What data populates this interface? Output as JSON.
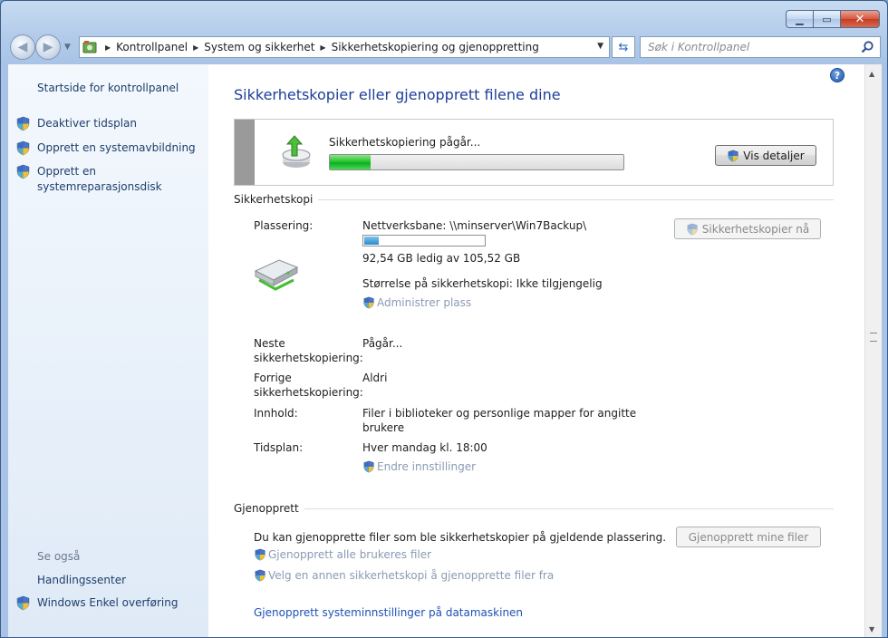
{
  "window": {
    "minimize_label": "▁",
    "maximize_label": "▭",
    "close_label": "✕"
  },
  "navbar": {
    "breadcrumbs": [
      "Kontrollpanel",
      "System og sikkerhet",
      "Sikkerhetskopiering og gjenoppretting"
    ],
    "search_placeholder": "Søk i Kontrollpanel"
  },
  "sidebar": {
    "home_label": "Startside for kontrollpanel",
    "items": [
      {
        "label": "Deaktiver tidsplan"
      },
      {
        "label": "Opprett en systemavbildning"
      },
      {
        "label": "Opprett en"
      },
      {
        "label": "systemreparasjonsdisk"
      }
    ],
    "see_also": "Se også",
    "see_also_items": [
      {
        "label": "Handlingssenter"
      },
      {
        "label": "Windows Enkel overføring"
      }
    ]
  },
  "main": {
    "title": "Sikkerhetskopier eller gjenopprett filene dine",
    "progress": {
      "label": "Sikkerhetskopiering pågår...",
      "fraction": 0.14,
      "details_button": "Vis detaljer"
    },
    "backup": {
      "section": "Sikkerhetskopi",
      "backup_now_button": "Sikkerhetskopier nå",
      "location_label": "Plassering:",
      "location_value": "Nettverksbane: \\\\minserver\\Win7Backup\\",
      "capacity_fraction": 0.12,
      "free_space": "92,54 GB ledig av 105,52 GB",
      "size": "Størrelse på sikkerhetskopi: Ikke tilgjengelig",
      "manage_space": "Administrer plass",
      "next_label_1": "Neste",
      "next_label_2": "sikkerhetskopiering:",
      "next_value": "Pågår...",
      "prev_label_1": "Forrige",
      "prev_label_2": "sikkerhetskopiering:",
      "prev_value": "Aldri",
      "content_label": "Innhold:",
      "content_value_1": "Filer i biblioteker og personlige mapper for angitte",
      "content_value_2": "brukere",
      "schedule_label": "Tidsplan:",
      "schedule_value": "Hver mandag kl. 18:00",
      "change_settings": "Endre innstillinger"
    },
    "restore": {
      "section": "Gjenopprett",
      "description": "Du kan gjenopprette filer som ble sikkerhetskopier på gjeldende plassering.",
      "restore_button": "Gjenopprett mine filer",
      "restore_all": "Gjenopprett alle brukeres filer",
      "select_other": "Velg en annen sikkerhetskopi å gjenopprette filer fra",
      "system_settings": "Gjenopprett systeminnstillinger på datamaskinen"
    }
  },
  "icons": {
    "shield": "uac-shield-icon",
    "help": "help-icon",
    "back": "back-arrow-icon",
    "forward": "forward-arrow-icon"
  },
  "colors": {
    "link": "#1e50b4",
    "title": "#1e3e9a",
    "progress_green": "#06b025"
  }
}
